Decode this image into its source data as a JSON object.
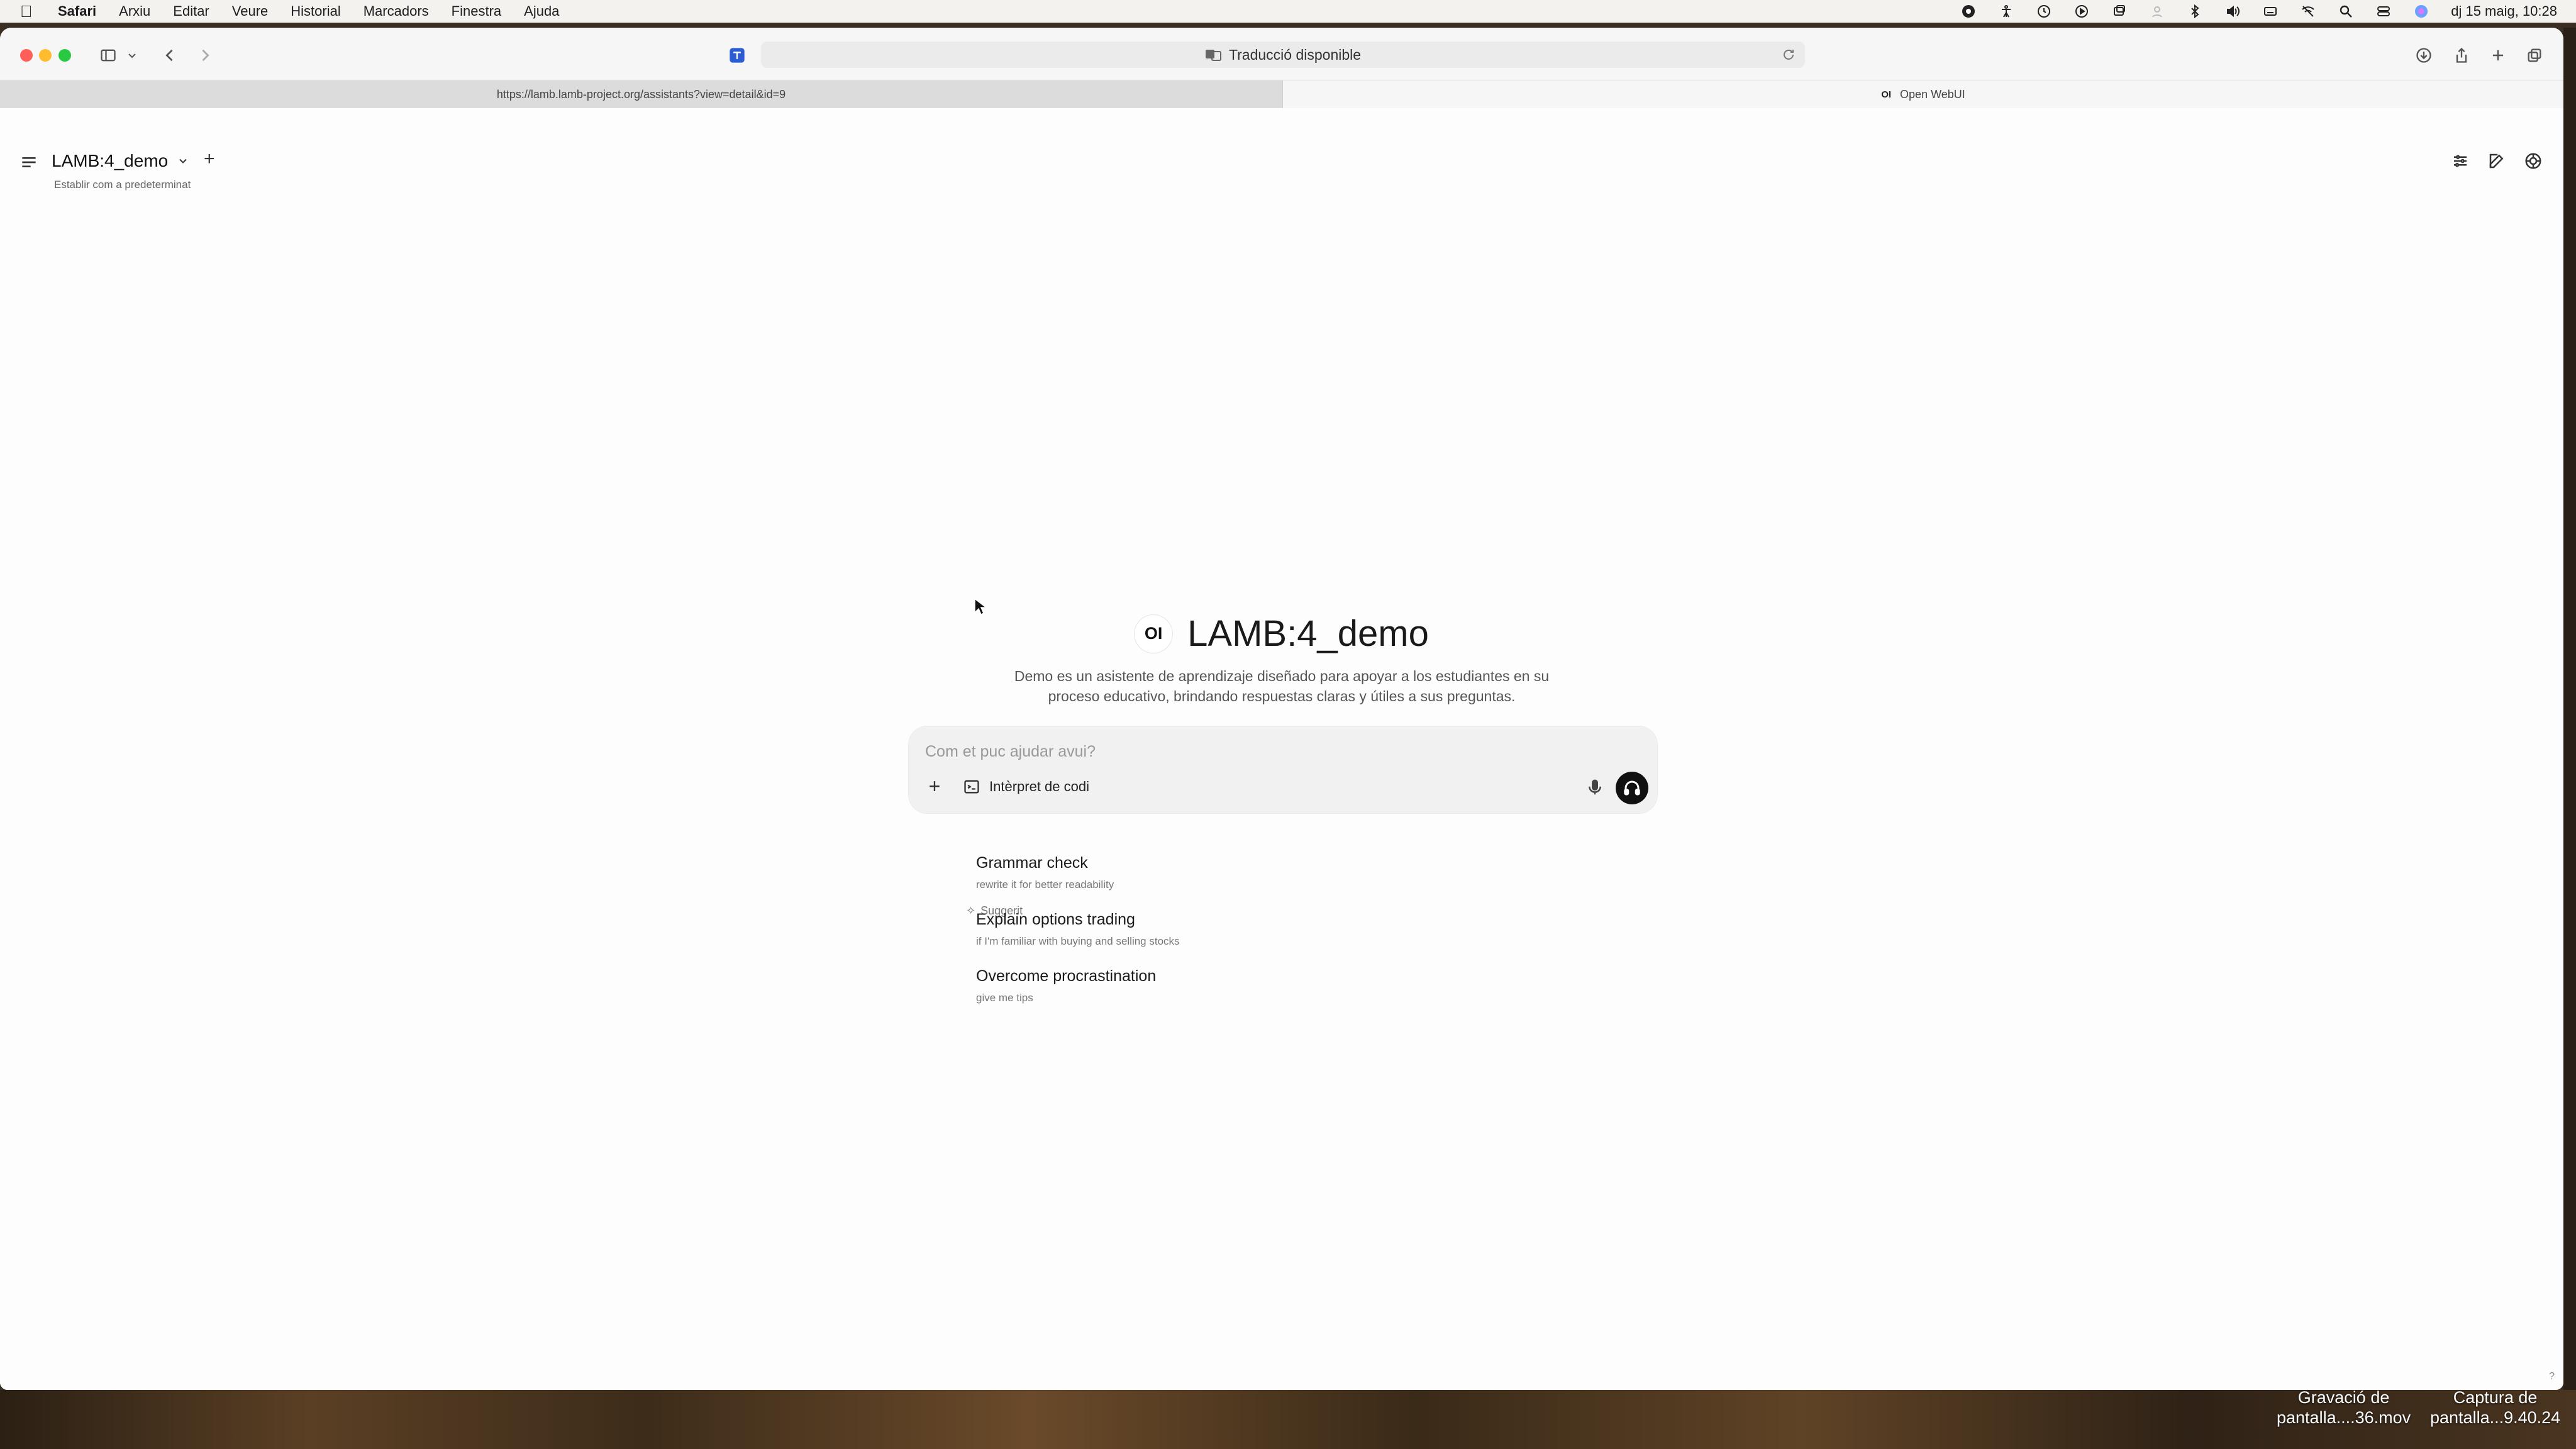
{
  "menubar": {
    "app": "Safari",
    "items": [
      "Arxiu",
      "Editar",
      "Veure",
      "Historial",
      "Marcadors",
      "Finestra",
      "Ajuda"
    ],
    "datetime": "dj 15 maig, 10:28"
  },
  "browser": {
    "address_text": "Traducció disponible",
    "tabs": [
      {
        "label": "https://lamb.lamb-project.org/assistants?view=detail&id=9",
        "active": false
      },
      {
        "label": "Open WebUI",
        "favicon": "OI",
        "active": true
      }
    ]
  },
  "page": {
    "model_name": "LAMB:4_demo",
    "add_label": "+",
    "set_default": "Establir com a predeterminat",
    "hero": {
      "logo": "OI",
      "title": "LAMB:4_demo",
      "description": "Demo es un asistente de aprendizaje diseñado para apoyar a los estudiantes en su proceso educativo, brindando respuestas claras y útiles a sus preguntas."
    },
    "chat": {
      "placeholder": "Com et puc ajudar avui?",
      "plus_label": "+",
      "code_interpreter_label": "Intèrpret de codi"
    },
    "suggested_label": "Suggerit",
    "suggestions": [
      {
        "title": "Grammar check",
        "subtitle": "rewrite it for better readability"
      },
      {
        "title": "Explain options trading",
        "subtitle": "if I'm familiar with buying and selling stocks"
      },
      {
        "title": "Overcome procrastination",
        "subtitle": "give me tips"
      }
    ],
    "help": "?"
  },
  "desktop": {
    "files": [
      {
        "line1": "Gravació de",
        "line2": "pantalla....36.mov"
      },
      {
        "line1": "Captura de",
        "line2": "pantalla...9.40.24"
      }
    ]
  },
  "colors": {
    "send_button": "#111111",
    "traffic_red": "#ff5f57",
    "traffic_yellow": "#febc2e",
    "traffic_green": "#28c840"
  }
}
